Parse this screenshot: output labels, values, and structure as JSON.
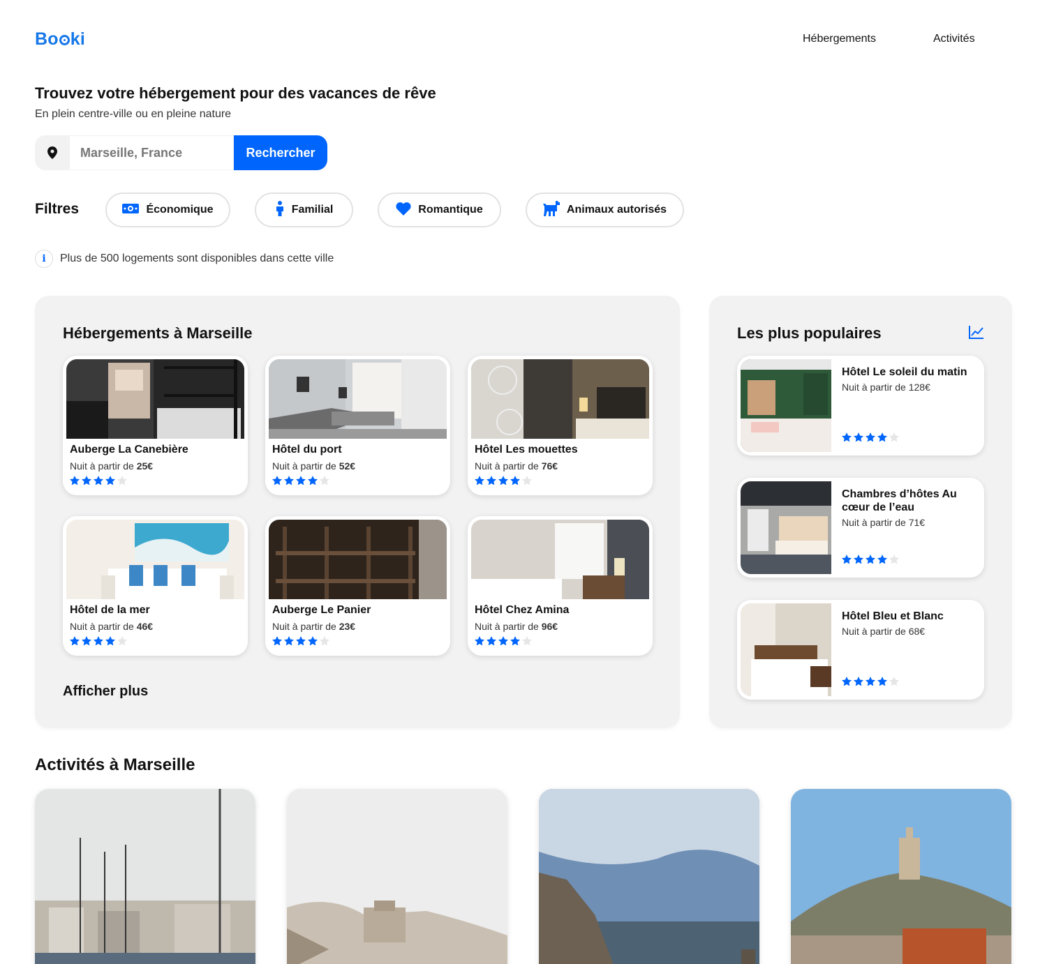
{
  "header": {
    "logo": "Booki",
    "nav": [
      "Hébergements",
      "Activités"
    ]
  },
  "hero": {
    "title": "Trouvez votre hébergement pour des vacances de rêve",
    "subtitle": "En plein centre-ville ou en pleine nature"
  },
  "search": {
    "value": "Marseille, France",
    "button": "Rechercher",
    "icon": "location-pin-icon"
  },
  "filters": {
    "label": "Filtres",
    "chips": [
      {
        "label": "Économique",
        "icon": "money-icon"
      },
      {
        "label": "Familial",
        "icon": "child-icon"
      },
      {
        "label": "Romantique",
        "icon": "heart-icon"
      },
      {
        "label": "Animaux autorisés",
        "icon": "dog-icon"
      }
    ]
  },
  "info": {
    "text": "Plus de 500 logements sont disponibles dans cette ville",
    "icon": "info-icon"
  },
  "hebergements": {
    "title": "Hébergements à Marseille",
    "price_prefix": "Nuit à partir de ",
    "items": [
      {
        "name": "Auberge La Canebière",
        "price": "25€",
        "rating": 4
      },
      {
        "name": "Hôtel du port",
        "price": "52€",
        "rating": 4
      },
      {
        "name": "Hôtel Les mouettes",
        "price": "76€",
        "rating": 4
      },
      {
        "name": "Hôtel de la mer",
        "price": "46€",
        "rating": 4
      },
      {
        "name": "Auberge Le Panier",
        "price": "23€",
        "rating": 4
      },
      {
        "name": "Hôtel Chez Amina",
        "price": "96€",
        "rating": 4
      }
    ],
    "more": "Afficher plus"
  },
  "populaires": {
    "title": "Les plus populaires",
    "icon": "trending-chart-icon",
    "items": [
      {
        "name": "Hôtel Le soleil du matin",
        "price": "Nuit à partir de 128€",
        "rating": 4
      },
      {
        "name": "Chambres d’hôtes Au cœur de l’eau",
        "price": "Nuit à partir de 71€",
        "rating": 4
      },
      {
        "name": "Hôtel Bleu et Blanc",
        "price": "Nuit à partir de 68€",
        "rating": 4
      }
    ]
  },
  "activites": {
    "title": "Activités à Marseille"
  },
  "colors": {
    "primary": "#0065fc",
    "logo": "#1677e8",
    "panel_bg": "#f2f2f2",
    "star_off": "#e6e6e6"
  }
}
